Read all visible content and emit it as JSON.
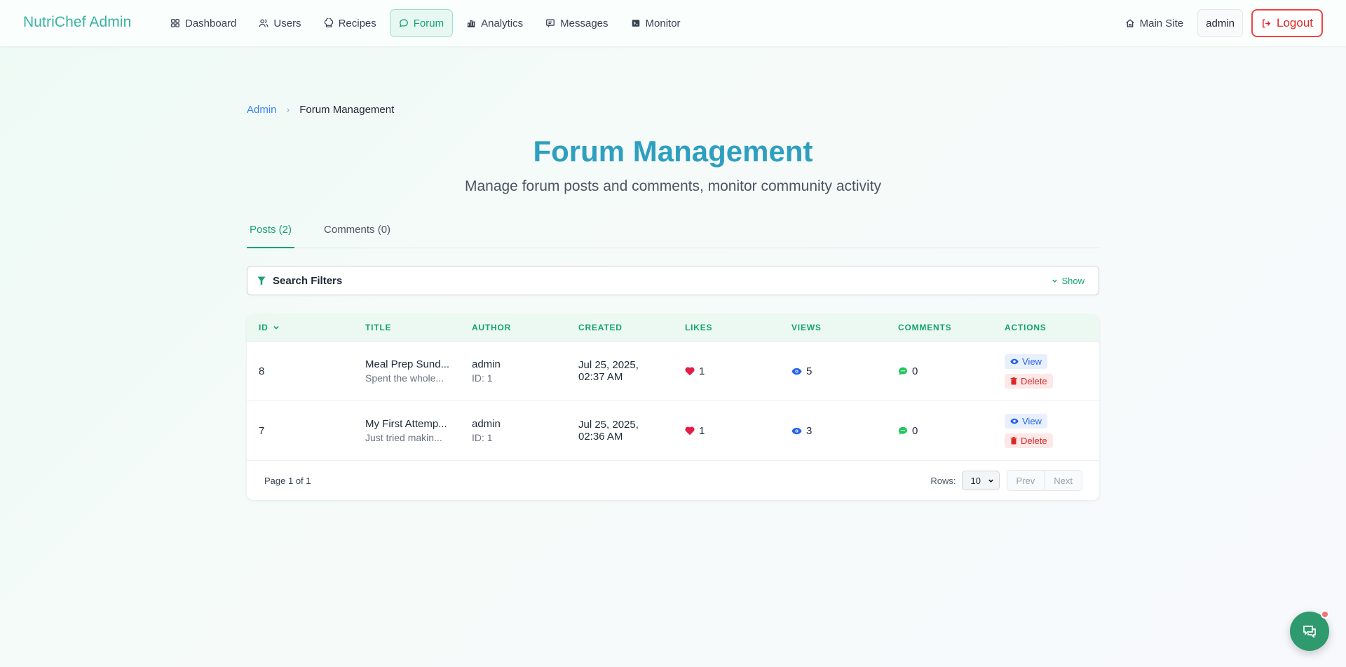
{
  "brand": "NutriChef Admin",
  "nav": {
    "items": [
      {
        "label": "Dashboard",
        "icon": "grid-icon"
      },
      {
        "label": "Users",
        "icon": "users-icon"
      },
      {
        "label": "Recipes",
        "icon": "chef-hat-icon"
      },
      {
        "label": "Forum",
        "icon": "chat-bubble-icon",
        "active": true
      },
      {
        "label": "Analytics",
        "icon": "bar-chart-icon"
      },
      {
        "label": "Messages",
        "icon": "message-square-icon"
      },
      {
        "label": "Monitor",
        "icon": "terminal-icon"
      }
    ],
    "main_site": "Main Site",
    "user": "admin",
    "logout": "Logout"
  },
  "breadcrumb": {
    "root": "Admin",
    "current": "Forum Management"
  },
  "page": {
    "title": "Forum Management",
    "subtitle": "Manage forum posts and comments, monitor community activity"
  },
  "tabs": [
    {
      "label": "Posts (2)",
      "active": true
    },
    {
      "label": "Comments (0)",
      "active": false
    }
  ],
  "filters": {
    "title": "Search Filters",
    "toggle": "Show"
  },
  "table": {
    "headers": [
      "ID",
      "TITLE",
      "AUTHOR",
      "CREATED",
      "LIKES",
      "VIEWS",
      "COMMENTS",
      "ACTIONS"
    ],
    "rows": [
      {
        "id": "8",
        "title": "Meal Prep Sund...",
        "excerpt": "Spent the whole...",
        "author": "admin",
        "author_id": "ID: 1",
        "created_date": "Jul 25, 2025,",
        "created_time": "02:37 AM",
        "likes": "1",
        "views": "5",
        "comments": "0"
      },
      {
        "id": "7",
        "title": "My First Attemp...",
        "excerpt": "Just tried makin...",
        "author": "admin",
        "author_id": "ID: 1",
        "created_date": "Jul 25, 2025,",
        "created_time": "02:36 AM",
        "likes": "1",
        "views": "3",
        "comments": "0"
      }
    ],
    "actions": {
      "view": "View",
      "delete": "Delete"
    }
  },
  "footer": {
    "page_info": "Page 1 of 1",
    "rows_label": "Rows:",
    "rows_value": "10",
    "prev": "Prev",
    "next": "Next"
  },
  "colors": {
    "accent": "#16a271",
    "title": "#2e9fbf",
    "danger": "#dc2626",
    "link": "#3b82f6"
  }
}
